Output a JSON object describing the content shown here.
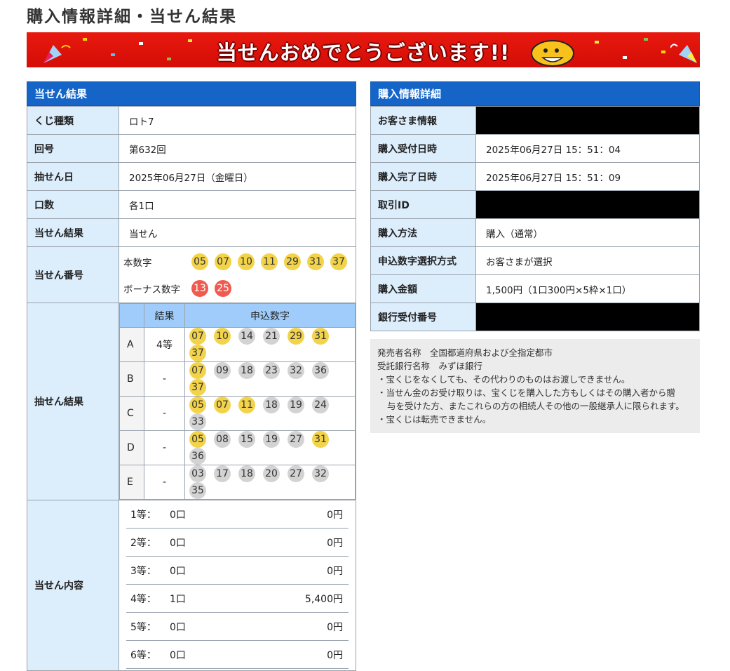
{
  "page_title": "購入情報詳細・当せん結果",
  "banner": {
    "text": "当せんおめでとうございます!!"
  },
  "result_panel": {
    "heading": "当せん結果",
    "rows": [
      {
        "label": "くじ種類",
        "value": "ロト7"
      },
      {
        "label": "回号",
        "value": "第632回"
      },
      {
        "label": "抽せん日",
        "value": "2025年06月27日（金曜日）"
      },
      {
        "label": "口数",
        "value": "各1口"
      },
      {
        "label": "当せん結果",
        "value": "当せん"
      }
    ],
    "winning_numbers": {
      "label": "当せん番号",
      "main_label": "本数字",
      "main": [
        "05",
        "07",
        "10",
        "11",
        "29",
        "31",
        "37"
      ],
      "bonus_label": "ボーナス数字",
      "bonus": [
        "13",
        "25"
      ]
    },
    "draw_result": {
      "label": "抽せん結果",
      "col_result": "結果",
      "col_numbers": "申込数字",
      "lines": [
        {
          "line": "A",
          "result": "4等",
          "numbers": [
            {
              "n": "07",
              "hit": true
            },
            {
              "n": "10",
              "hit": true
            },
            {
              "n": "14",
              "hit": false
            },
            {
              "n": "21",
              "hit": false
            },
            {
              "n": "29",
              "hit": true
            },
            {
              "n": "31",
              "hit": true
            },
            {
              "n": "37",
              "hit": true
            }
          ]
        },
        {
          "line": "B",
          "result": "-",
          "numbers": [
            {
              "n": "07",
              "hit": true
            },
            {
              "n": "09",
              "hit": false
            },
            {
              "n": "18",
              "hit": false
            },
            {
              "n": "23",
              "hit": false
            },
            {
              "n": "32",
              "hit": false
            },
            {
              "n": "36",
              "hit": false
            },
            {
              "n": "37",
              "hit": true
            }
          ]
        },
        {
          "line": "C",
          "result": "-",
          "numbers": [
            {
              "n": "05",
              "hit": true
            },
            {
              "n": "07",
              "hit": true
            },
            {
              "n": "11",
              "hit": true
            },
            {
              "n": "18",
              "hit": false
            },
            {
              "n": "19",
              "hit": false
            },
            {
              "n": "24",
              "hit": false
            },
            {
              "n": "33",
              "hit": false
            }
          ]
        },
        {
          "line": "D",
          "result": "-",
          "numbers": [
            {
              "n": "05",
              "hit": true
            },
            {
              "n": "08",
              "hit": false
            },
            {
              "n": "15",
              "hit": false
            },
            {
              "n": "19",
              "hit": false
            },
            {
              "n": "27",
              "hit": false
            },
            {
              "n": "31",
              "hit": true
            },
            {
              "n": "36",
              "hit": false
            }
          ]
        },
        {
          "line": "E",
          "result": "-",
          "numbers": [
            {
              "n": "03",
              "hit": false
            },
            {
              "n": "17",
              "hit": false
            },
            {
              "n": "18",
              "hit": false
            },
            {
              "n": "20",
              "hit": false
            },
            {
              "n": "27",
              "hit": false
            },
            {
              "n": "32",
              "hit": false
            },
            {
              "n": "35",
              "hit": false
            }
          ]
        }
      ]
    },
    "prize_content": {
      "label": "当せん内容",
      "rows": [
        {
          "rank": "1等：",
          "count": "0口",
          "amount": "0円"
        },
        {
          "rank": "2等：",
          "count": "0口",
          "amount": "0円"
        },
        {
          "rank": "3等：",
          "count": "0口",
          "amount": "0円"
        },
        {
          "rank": "4等：",
          "count": "1口",
          "amount": "5,400円"
        },
        {
          "rank": "5等：",
          "count": "0口",
          "amount": "0円"
        },
        {
          "rank": "6等：",
          "count": "0口",
          "amount": "0円"
        }
      ]
    }
  },
  "purchase_panel": {
    "heading": "購入情報詳細",
    "rows": [
      {
        "label": "お客さま情報",
        "value": "",
        "redacted": true
      },
      {
        "label": "購入受付日時",
        "value": "2025年06月27日 15：51：04",
        "redacted": false
      },
      {
        "label": "購入完了日時",
        "value": "2025年06月27日 15：51：09",
        "redacted": false
      },
      {
        "label": "取引ID",
        "value": "",
        "redacted": true
      },
      {
        "label": "購入方法",
        "value": "購入（通常）",
        "redacted": false
      },
      {
        "label": "申込数字選択方式",
        "value": "お客さまが選択",
        "redacted": false
      },
      {
        "label": "購入金額",
        "value": "1,500円（1口300円×5枠×1口）",
        "redacted": false
      },
      {
        "label": "銀行受付番号",
        "value": "",
        "redacted": true
      }
    ]
  },
  "notes": {
    "lines": [
      "発売者名称　全国都道府県および全指定都市",
      "受託銀行名称　みずほ銀行",
      "・宝くじをなくしても、その代わりのものはお渡しできません。",
      "・当せん金のお受け取りは、宝くじを購入した方もしくはその購入者から贈",
      "与を受けた方、またこれらの方の相続人その他の一般継承人に限られます。",
      "・宝くじは転売できません。"
    ]
  },
  "colors": {
    "header_blue": "#1565c9",
    "label_bg": "#dcedfc",
    "hit_ball": "#f2d34a",
    "miss_ball": "#d3d3d3",
    "bonus_ball": "#f05a4f",
    "banner_red": "#d40d06"
  }
}
